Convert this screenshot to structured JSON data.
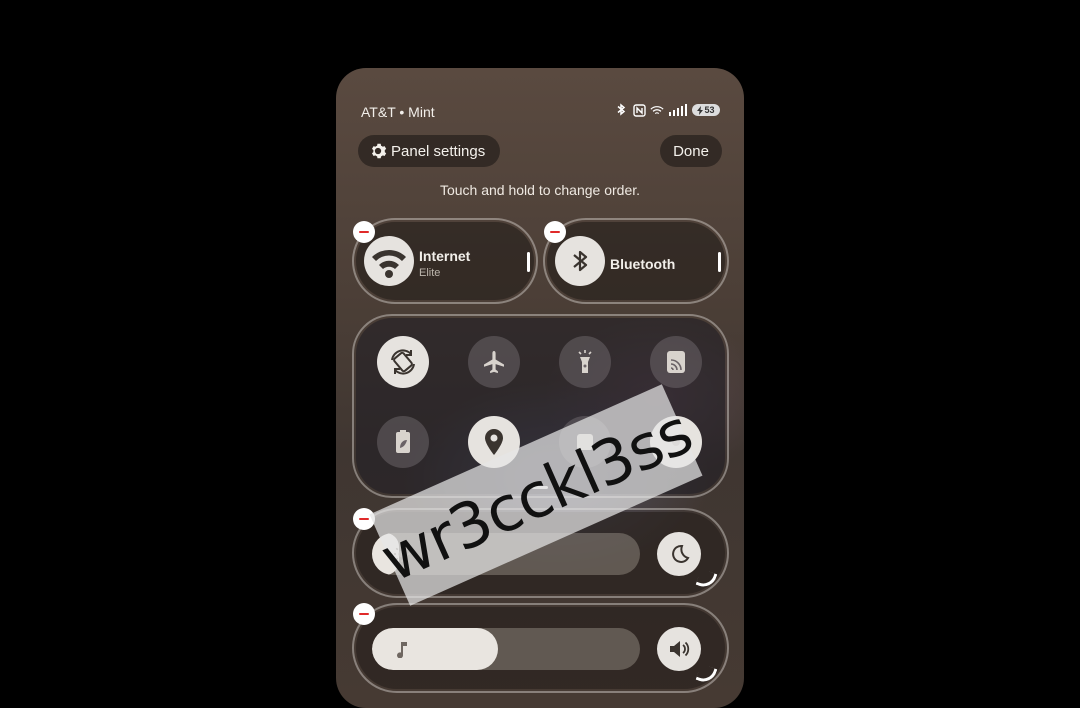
{
  "status_bar": {
    "carrier": "AT&T • Mint",
    "icons": [
      "bluetooth-icon",
      "nfc-icon",
      "wifi-calling-icon",
      "signal-icon"
    ],
    "battery_level": "53"
  },
  "header": {
    "panel_settings_label": "Panel settings",
    "done_label": "Done",
    "hint": "Touch and hold to change order."
  },
  "big_tiles": [
    {
      "label": "Internet",
      "sub": "Elite",
      "icon": "wifi-icon",
      "active": true
    },
    {
      "label": "Bluetooth",
      "sub": "",
      "icon": "bluetooth-icon",
      "active": true
    }
  ],
  "quick_toggles": [
    {
      "icon": "auto-rotate-icon",
      "active": true
    },
    {
      "icon": "airplane-icon",
      "active": false
    },
    {
      "icon": "flashlight-icon",
      "active": false
    },
    {
      "icon": "cast-icon",
      "active": false
    },
    {
      "icon": "power-saving-icon",
      "active": false
    },
    {
      "icon": "location-icon",
      "active": true
    },
    {
      "icon": "quick-share-icon",
      "active": false
    },
    {
      "icon": "toggle-icon",
      "active": true
    }
  ],
  "sliders": {
    "brightness": {
      "icon": "sun-icon",
      "side_icon": "moon-icon",
      "level": 0.1
    },
    "volume": {
      "icon": "music-note-icon",
      "side_icon": "speaker-icon",
      "level": 0.47
    }
  },
  "watermark": "wr3cckl3ss",
  "colors": {
    "remove_badge": "#e02a2a",
    "tile_active": "#e6e3df"
  }
}
